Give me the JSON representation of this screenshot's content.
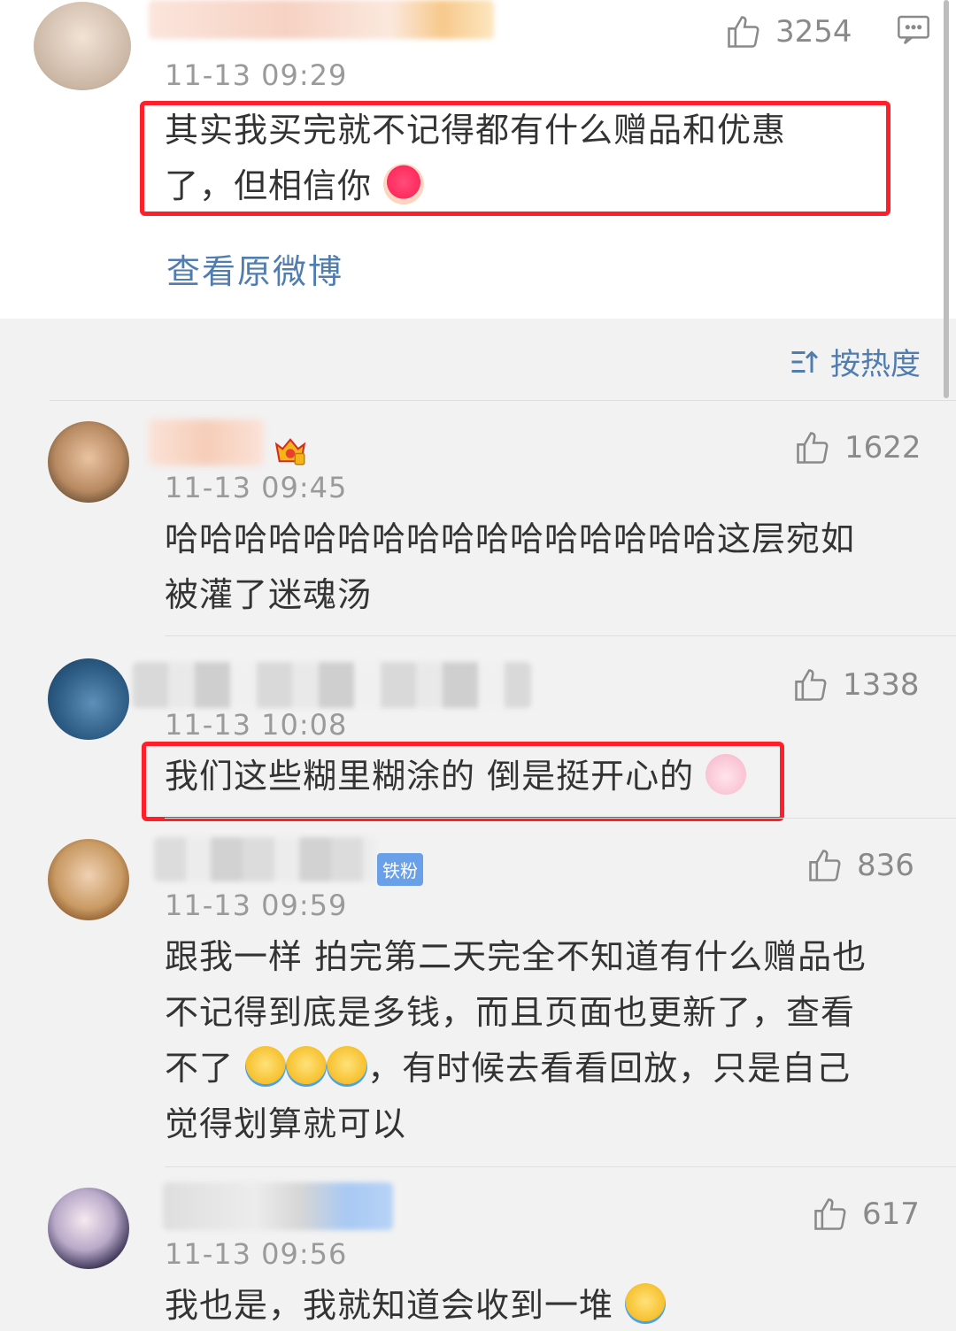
{
  "original_post": {
    "time": "11-13 09:29",
    "likes": "3254",
    "text_line1": "其实我买完就不记得都有什么赠品和优惠",
    "text_line2": "了，但相信你",
    "view_original": "查看原微博"
  },
  "sort": {
    "label": "按热度"
  },
  "comments": [
    {
      "time": "11-13 09:45",
      "likes": "1622",
      "line1": "哈哈哈哈哈哈哈哈哈哈哈哈哈哈哈哈这层宛如",
      "line2": "被灌了迷魂汤"
    },
    {
      "time": "11-13 10:08",
      "likes": "1338",
      "line1": "我们这些糊里糊涂的 倒是挺开心的"
    },
    {
      "time": "11-13 09:59",
      "likes": "836",
      "badge": "铁粉",
      "line1": "跟我一样 拍完第二天完全不知道有什么赠品也",
      "line2": "不记得到底是多钱，而且页面也更新了，查看",
      "line3a": "不了",
      "line3b": "，有时候去看看回放，只是自己",
      "line4": "觉得划算就可以"
    },
    {
      "time": "11-13 09:56",
      "likes": "617",
      "line1": "我也是，我就知道会收到一堆"
    }
  ]
}
